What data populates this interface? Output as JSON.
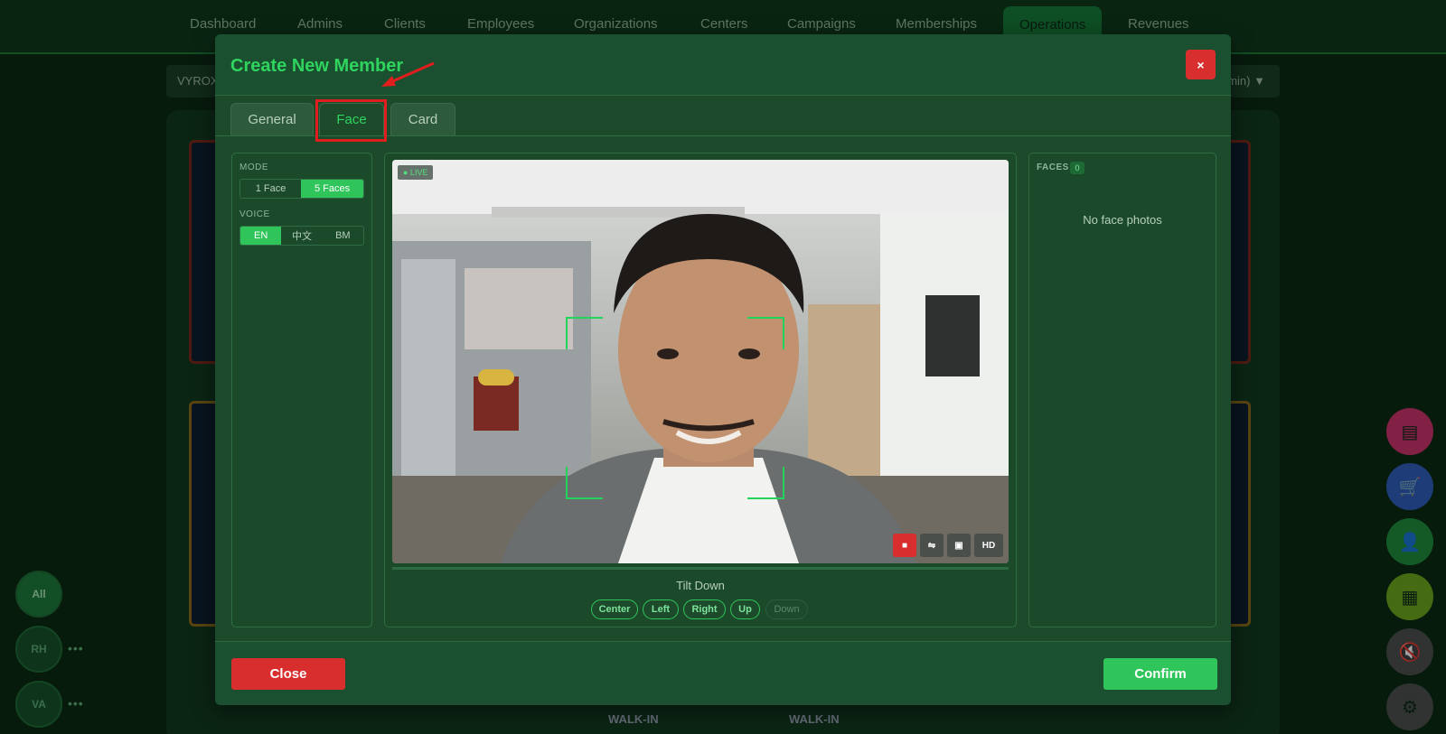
{
  "nav": {
    "items": [
      "Dashboard",
      "Admins",
      "Clients",
      "Employees",
      "Organizations",
      "Centers",
      "Campaigns",
      "Memberships",
      "Operations",
      "Revenues"
    ],
    "active": "Operations"
  },
  "toolbar": {
    "left_text": "VYROX",
    "right_text": "min)"
  },
  "background": {
    "walkin_label": "WALK-IN"
  },
  "left_rail": {
    "all": "All",
    "rh": "RH",
    "va": "VA",
    "more": "•••"
  },
  "modal": {
    "title": "Create New Member",
    "close_icon": "×",
    "tabs": [
      "General",
      "Face",
      "Card"
    ],
    "active_tab": "Face",
    "settings": {
      "mode_label": "MODE",
      "mode_options": [
        "1 Face",
        "5 Faces"
      ],
      "mode_selected": "5 Faces",
      "voice_label": "VOICE",
      "voice_options": [
        "EN",
        "中文",
        "BM"
      ],
      "voice_selected": "EN"
    },
    "camera": {
      "live_label": "● LIVE",
      "controls": {
        "stop": "■",
        "flip": "⇋",
        "snapshot": "▣",
        "hd": "HD"
      },
      "instruction": "Tilt Down",
      "poses": [
        "Center",
        "Left",
        "Right",
        "Up",
        "Down"
      ],
      "poses_done": 4
    },
    "faces": {
      "label": "FACES",
      "count": "0",
      "empty_text": "No face photos"
    },
    "footer": {
      "close_label": "Close",
      "confirm_label": "Confirm"
    }
  },
  "colors": {
    "accent": "#2fd45f",
    "danger": "#d82e2e",
    "panel": "#1c4a2b"
  }
}
